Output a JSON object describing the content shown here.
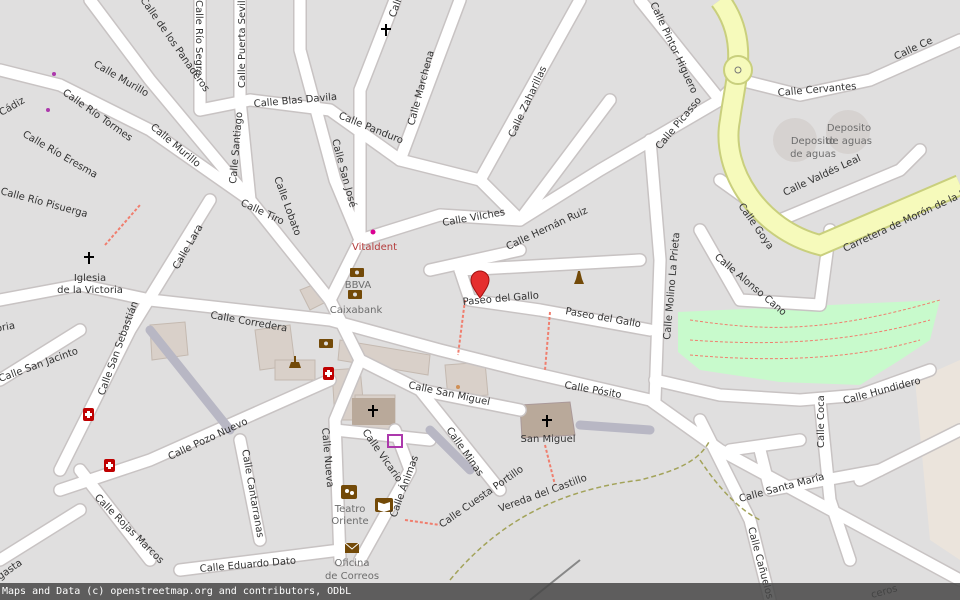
{
  "colors": {
    "background": "#e0dfdf",
    "road": "#ffffff",
    "road_casing": "#c8c3c3",
    "highway_fill": "#f6fabb",
    "highway_casing": "#c9cf7d",
    "park": "#c8facc",
    "path_red": "#f07e6e",
    "marker": "#e52e2e",
    "building": "#d9d0c9"
  },
  "streets": {
    "rio_panaderos": "Calle de los Panaderos",
    "rio_segre": "Calle Río Segre",
    "puerta_sevilla": "Calle Puerta Sevilla",
    "marchena_top": "Calle",
    "murillo1": "Calle Murillo",
    "murillo2": "Calle Murillo",
    "rio_tormes": "Calle Río Tormes",
    "diego_cadiz": "Diego de Cádiz",
    "rio_eresma": "Calle Río Eresma",
    "rio_pisuerga": "Calle Río Pisuerga",
    "blas_davila": "Calle Blas Davila",
    "santiago": "Calle Santiago",
    "marchena": "Calle Marchena",
    "panduro": "Calle Panduro",
    "san_jose": "Calle San José",
    "zaharillas": "Calle Zaharillas",
    "pintor_higuero": "Calle Pintor Higuero",
    "cervantes": "Calle Cervantes",
    "calle_ce": "Calle Ce",
    "picasso": "Calle Picasso",
    "valdes_leal": "Calle Valdés Leal",
    "carretera": "Carretera de Morón de la Fr",
    "goya": "Calle Goya",
    "alonso_cano": "Calle Alonso Cano",
    "lobato": "Calle Lobato",
    "tiro": "Calle Tiro",
    "lara": "Calle Lara",
    "vilches": "Calle Vilches",
    "hernan_ruiz": "Calle Hernán Ruiz",
    "molino": "Calle Molino La Prieta",
    "paseo_gallo1": "Paseo del Gallo",
    "paseo_gallo2": "Paseo del Gallo",
    "corredera": "Calle Corredera",
    "victoria_left": "Victoria",
    "san_jacinto": "Calle San Jacinto",
    "san_sebastian": "Calle San Sebastián",
    "posito": "Calle Pósito",
    "san_miguel": "Calle San Miguel",
    "hundidero": "Calle Hundidero",
    "pozo_nuevo": "Calle Pozo Nuevo",
    "nueva": "Calle Nueva",
    "vicario": "Calle Vicario",
    "animas": "Calle Ánimas",
    "minas": "Calle Minas",
    "cuesta_portillo": "Calle Cuesta Portillo",
    "vereda_castillo": "Vereda del Castillo",
    "coca": "Calle Coca",
    "santa_maria": "Calle Santa María",
    "canuelos": "Calle Cañuelos",
    "cantarranas": "Calle Cantarranas",
    "rojas_marcos": "Calle Rojas Marcos",
    "eduardo_dato": "Calle Eduardo Dato",
    "gasta": "gasta",
    "ceros": "ceros"
  },
  "pois": {
    "iglesia_victoria_line1": "Iglesia",
    "iglesia_victoria_line2": "de la Victoria",
    "vitaldent": "Vitaldent",
    "bbva": "BBVA",
    "caixabank": "Caixabank",
    "deposito1_line1": "Deposito",
    "deposito1_line2": "de aguas",
    "deposito2_line1": "Deposito",
    "deposito2_line2": "de aguas",
    "san_miguel": "San Miguel",
    "teatro_line1": "Teatro",
    "teatro_line2": "Oriente",
    "correos_line1": "Oficina",
    "correos_line2": "de Correos"
  },
  "icons": [
    "church-icon",
    "bank-icon",
    "pharmacy-icon",
    "theatre-icon",
    "library-icon",
    "post-office-icon",
    "monument-icon",
    "fountain-icon",
    "shop-icon",
    "map-marker-icon"
  ],
  "attribution": "Maps and Data (c) openstreetmap.org and contributors, ODbL"
}
